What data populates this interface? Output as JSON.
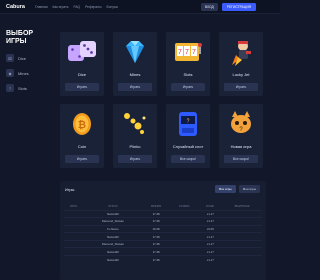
{
  "header": {
    "logo": "Cabura",
    "nav": [
      "Главная",
      "Как играть",
      "FAQ",
      "Рефералы",
      "Бонусы"
    ],
    "login_label": "ВХОД",
    "register_label": "РЕГИСТРАЦИЯ"
  },
  "sidebar": {
    "title": "ВЫБОР ИГРЫ",
    "items": [
      {
        "label": "Dice",
        "icon": "dice-icon"
      },
      {
        "label": "Mines",
        "icon": "mines-icon"
      },
      {
        "label": "Slots",
        "icon": "slots-icon"
      }
    ]
  },
  "games": [
    {
      "name": "Dice",
      "button": "Играть",
      "icon": "dice-icon"
    },
    {
      "name": "Mines",
      "button": "Играть",
      "icon": "diamond-icon"
    },
    {
      "name": "Slots",
      "button": "Играть",
      "icon": "slot-machine-icon"
    },
    {
      "name": "Lucky Jet",
      "button": "Играть",
      "icon": "jetpack-icon"
    },
    {
      "name": "Coin",
      "button": "Играть",
      "icon": "coin-icon"
    },
    {
      "name": "Plinko",
      "button": "Играть",
      "icon": "plinko-icon"
    },
    {
      "name": "Случайный слот",
      "button": "Все скоро!",
      "icon": "random-slot-icon"
    },
    {
      "name": "Новая игра",
      "button": "Все скоро!",
      "icon": "cat-icon"
    }
  ],
  "history": {
    "title": "Игры",
    "tabs": [
      "Все игры",
      "Мои игры"
    ],
    "columns": [
      "ИГРА",
      "ИГРОК",
      "ВРЕМЯ",
      "СТАВКА",
      "КОЭФ.",
      "ВЫИГРЫШ"
    ],
    "rows": [
      [
        "",
        "Naruto99",
        "17:48",
        "",
        "x1.17",
        ""
      ],
      [
        "",
        "Diamond_Slotsan",
        "17:48",
        "",
        "x1.17",
        ""
      ],
      [
        "",
        "Fo Name",
        "16:28",
        "",
        "x0.05",
        ""
      ],
      [
        "",
        "Naruto99",
        "17:48",
        "",
        "x1.17",
        ""
      ],
      [
        "",
        "Diamond_Slotsan",
        "17:48",
        "",
        "x1.17",
        ""
      ],
      [
        "",
        "Naruto99",
        "17:48",
        "",
        "x1.17",
        ""
      ],
      [
        "",
        "Naruto99",
        "17:48",
        "",
        "x1.17",
        ""
      ]
    ]
  },
  "colors": {
    "background": "#121829",
    "card": "#1a2238",
    "accent": "#3b5bff"
  }
}
